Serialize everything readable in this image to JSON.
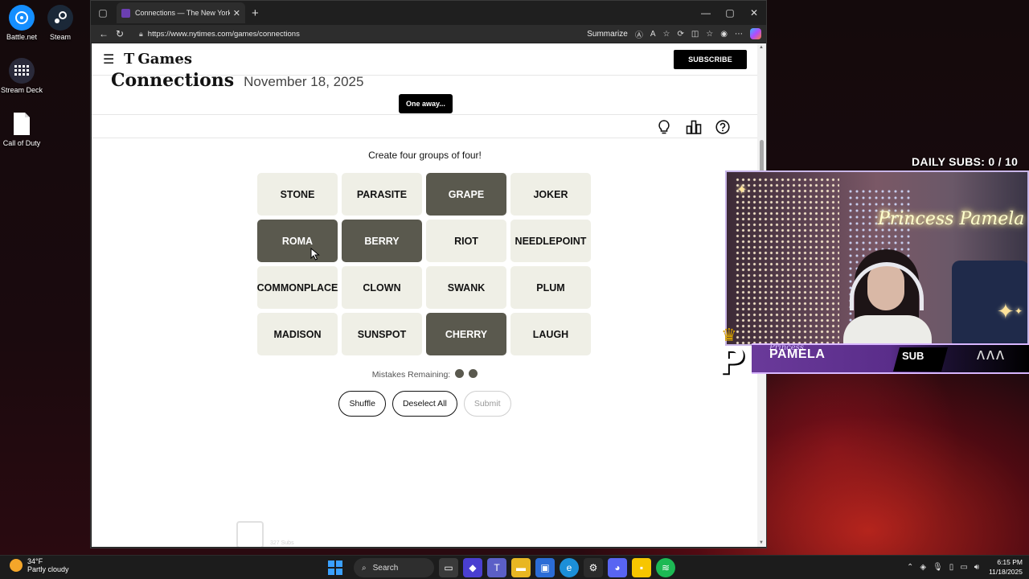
{
  "desktop": {
    "icons": [
      {
        "label": "Battle.net",
        "icon": "battlenet-icon",
        "color": "#148eff"
      },
      {
        "label": "Steam",
        "icon": "steam-icon",
        "color": "#1b2838"
      },
      {
        "label": "Stream Deck",
        "icon": "stream-deck-icon",
        "color": "#2a2a3a"
      },
      {
        "label": "Call of Duty",
        "icon": "file-icon",
        "color": "#ffffff"
      }
    ]
  },
  "browser": {
    "tab_title": "Connections — The New York Tim",
    "url": "https://www.nytimes.com/games/connections",
    "summarize_label": "Summarize"
  },
  "nyt": {
    "brand": "Games",
    "logo_letter": "T",
    "subscribe_label": "SUBSCRIBE",
    "game_title": "Connections",
    "game_date": "November 18, 2025",
    "toast": "One away...",
    "instructions": "Create four groups of four!",
    "tiles": [
      {
        "word": "STONE",
        "selected": false
      },
      {
        "word": "PARASITE",
        "selected": false
      },
      {
        "word": "GRAPE",
        "selected": true
      },
      {
        "word": "JOKER",
        "selected": false
      },
      {
        "word": "ROMA",
        "selected": true
      },
      {
        "word": "BERRY",
        "selected": true
      },
      {
        "word": "RIOT",
        "selected": false
      },
      {
        "word": "NEEDLEPOINT",
        "selected": false
      },
      {
        "word": "COMMONPLACE",
        "selected": false
      },
      {
        "word": "CLOWN",
        "selected": false
      },
      {
        "word": "SWANK",
        "selected": false
      },
      {
        "word": "PLUM",
        "selected": false
      },
      {
        "word": "MADISON",
        "selected": false
      },
      {
        "word": "SUNSPOT",
        "selected": false
      },
      {
        "word": "CHERRY",
        "selected": true
      },
      {
        "word": "LAUGH",
        "selected": false
      }
    ],
    "mistakes_label": "Mistakes Remaining:",
    "mistakes_remaining": 2,
    "buttons": {
      "shuffle": "Shuffle",
      "deselect": "Deselect All",
      "submit": "Submit"
    },
    "ghost_overlay": {
      "subs": "327 Subs"
    }
  },
  "stream": {
    "daily_subs": "DAILY SUBS:  0 / 10",
    "neon_sign": "Princess Pamela",
    "name_script": "Princess",
    "name": "PAMELA",
    "sub_tag": "SUB",
    "logo_letter": "P"
  },
  "taskbar": {
    "temperature": "34°F",
    "weather": "Partly cloudy",
    "search_label": "Search",
    "time": "6:15 PM",
    "date": "11/18/2025"
  },
  "colors": {
    "tile_bg": "#efefe6",
    "tile_selected": "#5a594e",
    "accent_black": "#000000"
  }
}
